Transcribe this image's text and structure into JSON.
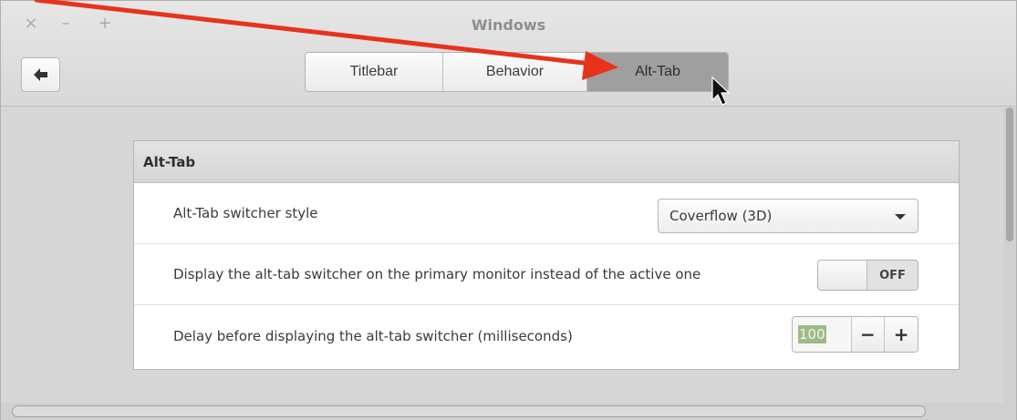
{
  "window": {
    "title": "Windows",
    "controls": {
      "close": "×",
      "minimize": "–",
      "maximize": "+"
    }
  },
  "tabs": [
    {
      "label": "Titlebar",
      "active": false
    },
    {
      "label": "Behavior",
      "active": false
    },
    {
      "label": "Alt-Tab",
      "active": true
    }
  ],
  "section": {
    "title": "Alt-Tab",
    "rows": [
      {
        "label": "Alt-Tab switcher style",
        "control": "dropdown",
        "value": "Coverflow (3D)"
      },
      {
        "label": "Display the alt-tab switcher on the primary monitor instead of the active one",
        "control": "switch",
        "state": "OFF"
      },
      {
        "label": "Delay before displaying the alt-tab switcher (milliseconds)",
        "control": "spinbutton",
        "value": "100",
        "decrement": "−",
        "increment": "+"
      }
    ]
  },
  "icons": {
    "back": "back-arrow-icon",
    "annotation": "red-arrow-annotation",
    "cursor": "mouse-pointer-icon"
  },
  "colors": {
    "annotation_arrow": "#e8321c",
    "active_tab": "#9f9f9f",
    "selected_text_bg": "#9dbb87"
  }
}
